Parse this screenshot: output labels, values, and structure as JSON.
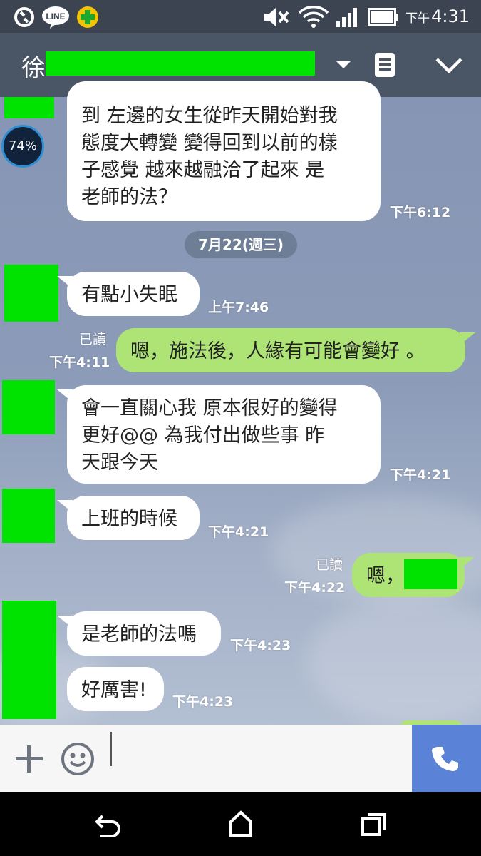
{
  "status_bar": {
    "time_prefix": "下午",
    "time": "4:31",
    "icons": [
      "sync-icon",
      "line-icon",
      "plus-app-icon",
      "mute-icon",
      "wifi-icon",
      "signal-icon",
      "battery-icon"
    ]
  },
  "header": {
    "title": "徐",
    "icons": [
      "dropdown-arrow-icon",
      "notes-icon",
      "chevron-down-icon"
    ]
  },
  "battery_widget": {
    "percent": "74%"
  },
  "messages": [
    {
      "side": "in",
      "text": "到 左邊的女生從昨天開始對我\n態度大轉變 變得回到以前的樣\n子感覺 越來越融洽了起來 是\n老師的法？",
      "time": "下午6:12"
    },
    {
      "side": "in",
      "text": "有點小失眠",
      "time": "上午7:46"
    },
    {
      "side": "out",
      "text": "嗯，施法後，人緣有可能會變好 。",
      "time": "下午4:11",
      "read": "已讀"
    },
    {
      "side": "in",
      "text": "會一直關心我 原本很好的變得\n更好@@ 為我付出做些事 昨\n天跟今天",
      "time": "下午4:21"
    },
    {
      "side": "in",
      "text": "上班的時候",
      "time": "下午4:21"
    },
    {
      "side": "out",
      "text": "嗯，",
      "time": "下午4:22",
      "read": "已讀"
    },
    {
      "side": "in",
      "text": "是老師的法嗎",
      "time": "下午4:23"
    },
    {
      "side": "in",
      "text": "好厲害!",
      "time": "下午4:23"
    }
  ],
  "date_separator": "7月22(週三)",
  "input_bar": {
    "icons": [
      "add-icon",
      "emoji-icon",
      "call-icon"
    ],
    "placeholder": ""
  },
  "nav_bar": {
    "icons": [
      "back-icon",
      "home-icon",
      "recents-icon"
    ]
  },
  "colors": {
    "header": "#4a5566",
    "bubble_out": "#aee476",
    "call_button": "#5a82d6",
    "redaction": "#00e300"
  }
}
